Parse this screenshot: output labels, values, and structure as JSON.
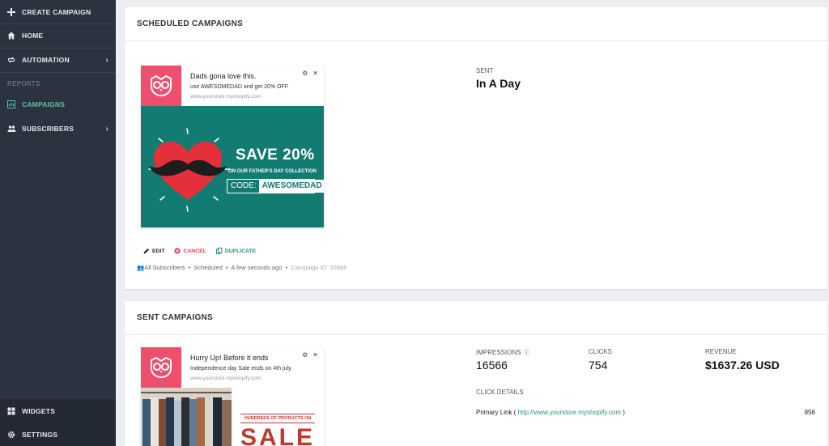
{
  "sidebar": {
    "items": [
      {
        "label": "CREATE CAMPAIGN",
        "icon": "plus-icon"
      },
      {
        "label": "HOME",
        "icon": "home-icon"
      },
      {
        "label": "AUTOMATION",
        "icon": "repeat-icon"
      },
      {
        "label": "CAMPAIGNS",
        "icon": "chart-icon"
      },
      {
        "label": "SUBSCRIBERS",
        "icon": "people-icon"
      }
    ],
    "section_reports": "REPORTS",
    "bottom_items": [
      {
        "label": "WIDGETS",
        "icon": "grid-icon"
      },
      {
        "label": "SETTINGS",
        "icon": "gear-icon"
      }
    ]
  },
  "scheduled": {
    "title": "SCHEDULED CAMPAIGNS",
    "notification": {
      "title": "Dads gona love this.",
      "message": "use AWESOMEDAD and get 20% OFF",
      "url": "www.yourstore.myshopify.com"
    },
    "banner": {
      "headline": "SAVE 20%",
      "sub": "ON OUR FATHER'S DAY COLLECTION",
      "code_label": "CODE:",
      "code": "AWESOMEDAD"
    },
    "actions": {
      "edit": "EDIT",
      "cancel": "CANCEL",
      "duplicate": "DUPLICATE"
    },
    "meta": {
      "audience": "All Subscribers",
      "status": "Scheduled",
      "time": "A few seconds ago",
      "campaign_id": "Campaign ID: 32884"
    },
    "sent_label": "SENT",
    "sent_value": "In A Day"
  },
  "sent": {
    "title": "SENT CAMPAIGNS",
    "notification": {
      "title": "Hurry Up! Before it ends",
      "message": "Independence day Sale ends on 4th july.",
      "url": "www.yourstore.myshopify.com"
    },
    "banner": {
      "tag": "HUNDREDS OF PRODUCTS ON",
      "headline": "SALE"
    },
    "stats": {
      "impressions_label": "IMPRESSIONS",
      "impressions": "16566",
      "clicks_label": "CLICKS",
      "clicks": "754",
      "revenue_label": "REVENUE",
      "revenue": "$1637.26 USD"
    },
    "click_details_label": "CLICK DETAILS",
    "primary_link_label": "Primary Link (",
    "primary_link_url": "http://www.yourstore.myshopify.com",
    "primary_link_close": ")",
    "primary_link_count": "856"
  },
  "colors": {
    "sidebar_bg": "#2b3340",
    "accent_green": "#5bc2a5",
    "brand_pink": "#ee4f6f",
    "banner_teal": "#127b72",
    "cancel_red": "#e53950",
    "link_teal": "#2a8d7c"
  }
}
